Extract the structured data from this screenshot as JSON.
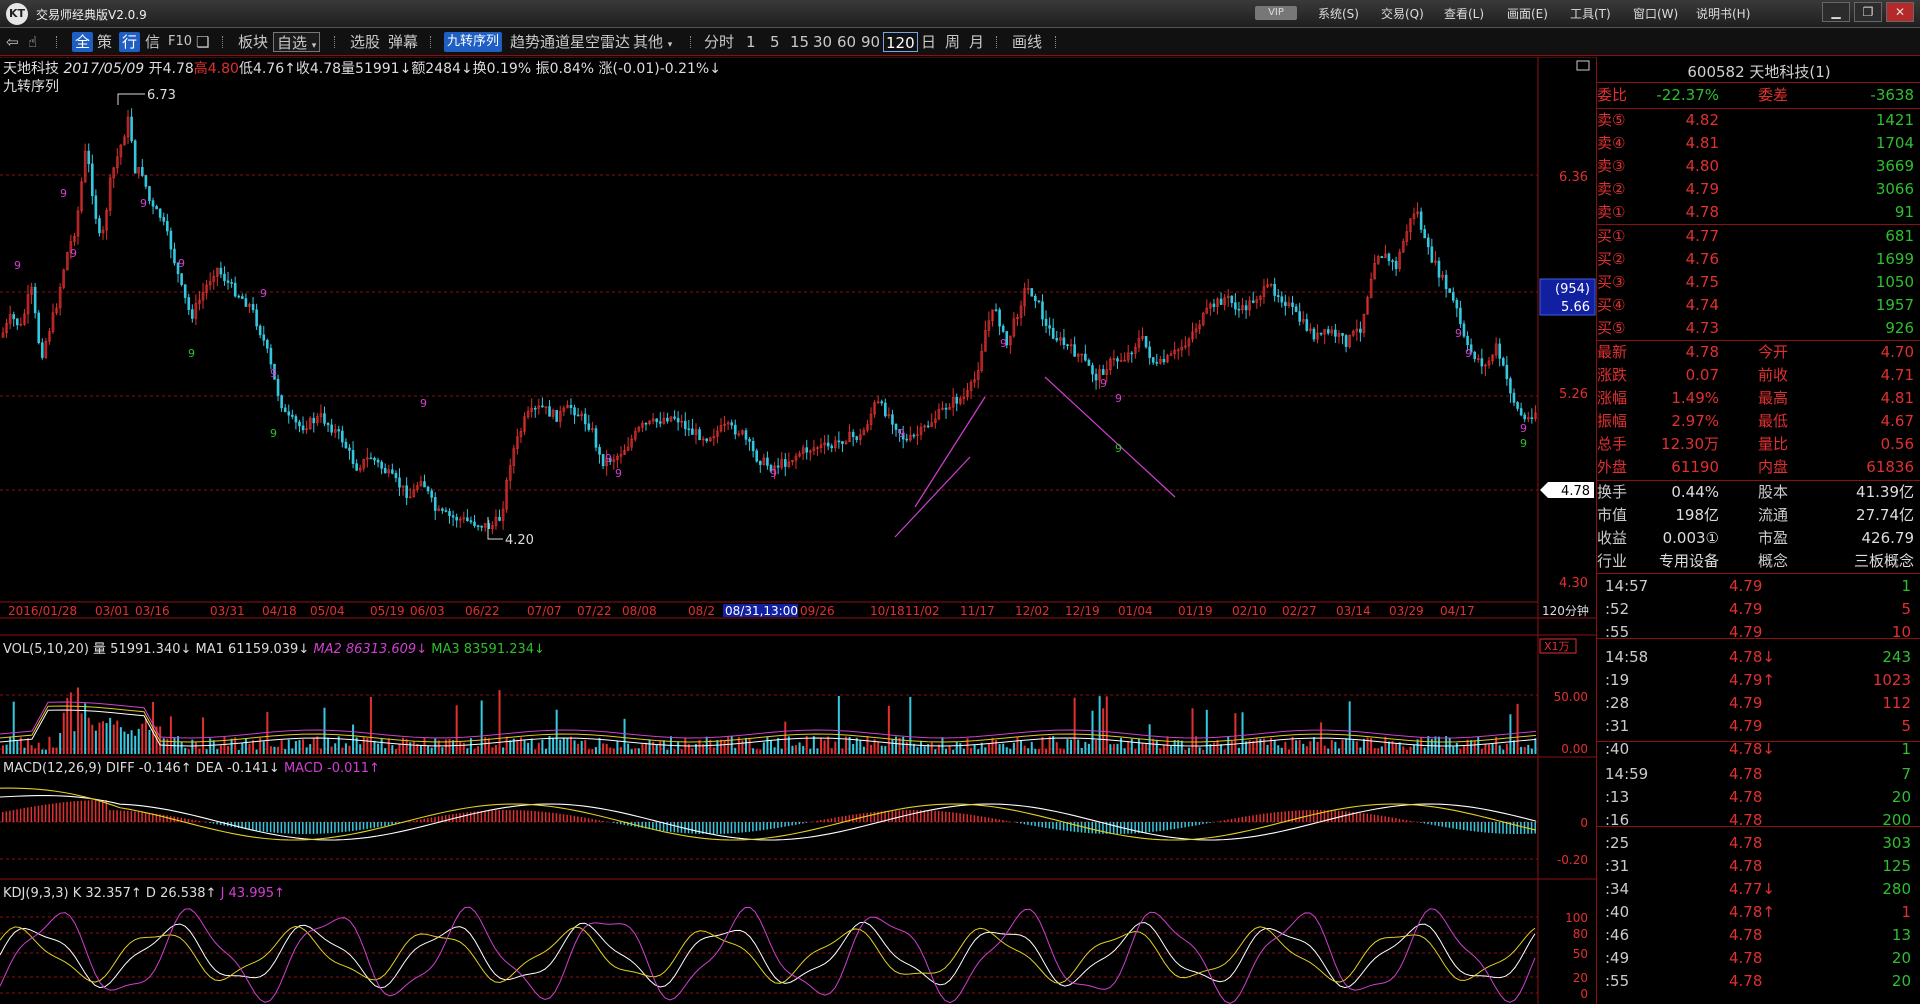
{
  "app": {
    "title": "交易师经典版V2.0.9",
    "logo_text": "KT",
    "vip": "VIP"
  },
  "menu": [
    "系统(S)",
    "交易(Q)",
    "查看(L)",
    "画面(E)",
    "工具(T)",
    "窗口(W)",
    "说明书(H)"
  ],
  "toolbar": {
    "quick": [
      "全",
      "策",
      "行",
      "信",
      "F10"
    ],
    "bankuai": "板块",
    "zixuan": "自选",
    "items": [
      "选股",
      "弹幕"
    ],
    "indicator_active": "九转序列",
    "items2": [
      "趋势通道",
      "星空雷达",
      "其他"
    ],
    "fenshi": "分时",
    "periods": [
      "1",
      "5",
      "15",
      "30",
      "60",
      "90",
      "120",
      "日",
      "周",
      "月"
    ],
    "period_active": "120",
    "huaxian": "画线"
  },
  "chart": {
    "header": {
      "name": "天地科技",
      "date": "2017/05/09",
      "open": "开4.78",
      "high": "高4.80",
      "low": "低4.76↑",
      "close": "收4.78",
      "volume": "量51991↓",
      "amount": "额2484↓",
      "turnover": "换0.19%",
      "amplitude": "振0.84%",
      "change": "涨(-0.01)-0.21%↓"
    },
    "indicator_name": "九转序列",
    "price_axis": [
      "6.36",
      "5.26",
      "4.30"
    ],
    "crosshair_label_top": "(954)",
    "crosshair_label_price": "5.66",
    "last_price_tag": "4.78",
    "high_annotation": "6.73",
    "low_annotation": "4.20",
    "period_label": "120分钟",
    "dates": [
      "2016/01/28",
      "03/01",
      "03/16",
      "03/31",
      "04/18",
      "05/04",
      "05/19",
      "06/03",
      "06/22",
      "07/07",
      "07/22",
      "08/08",
      "08/2",
      "08/31,13:00",
      "09/26",
      "10/18",
      "11/02",
      "11/17",
      "12/02",
      "12/19",
      "01/04",
      "01/19",
      "02/10",
      "02/27",
      "03/14",
      "03/29",
      "04/17"
    ],
    "vol": {
      "label": "VOL(5,10,20)",
      "vol": "量 51991.340↓",
      "ma1": "MA1 61159.039↓",
      "ma2": "MA2 86313.609↓",
      "ma3": "MA3 83591.234↓",
      "unit": "X1万",
      "axis": [
        "50.00",
        "0.00"
      ]
    },
    "macd": {
      "label": "MACD(12,26,9)",
      "diff": "DIFF -0.146↑",
      "dea": "DEA -0.141↓",
      "macd": "MACD -0.011↑",
      "axis": [
        "0",
        "-0.20"
      ]
    },
    "kdj": {
      "label": "KDJ(9,3,3)",
      "k": "K 32.357↑",
      "d": "D 26.538↑",
      "j": "J 43.995↑",
      "axis": [
        "100",
        "80",
        "50",
        "20",
        "0"
      ]
    },
    "colors": {
      "up": "#e03030",
      "down": "#35c8e0",
      "grid": "#8c1010",
      "ma1": "#ffffff",
      "ma2": "#e0d020",
      "ma3": "#d040d0"
    }
  },
  "quote": {
    "title": "600582 天地科技(1)",
    "weibi_label": "委比",
    "weibi": "-22.37%",
    "weicha_label": "委差",
    "weicha": "-3638",
    "asks": [
      {
        "label": "卖⑤",
        "price": "4.82",
        "vol": "1421"
      },
      {
        "label": "卖④",
        "price": "4.81",
        "vol": "1704"
      },
      {
        "label": "卖③",
        "price": "4.80",
        "vol": "3669"
      },
      {
        "label": "卖②",
        "price": "4.79",
        "vol": "3066"
      },
      {
        "label": "卖①",
        "price": "4.78",
        "vol": "91"
      }
    ],
    "bids": [
      {
        "label": "买①",
        "price": "4.77",
        "vol": "681"
      },
      {
        "label": "买②",
        "price": "4.76",
        "vol": "1699"
      },
      {
        "label": "买③",
        "price": "4.75",
        "vol": "1050"
      },
      {
        "label": "买④",
        "price": "4.74",
        "vol": "1957"
      },
      {
        "label": "买⑤",
        "price": "4.73",
        "vol": "926"
      }
    ],
    "stats1": [
      {
        "l": "最新",
        "v": "4.78",
        "l2": "今开",
        "v2": "4.70"
      },
      {
        "l": "涨跌",
        "v": "0.07",
        "l2": "前收",
        "v2": "4.71"
      },
      {
        "l": "涨幅",
        "v": "1.49%",
        "l2": "最高",
        "v2": "4.81"
      },
      {
        "l": "振幅",
        "v": "2.97%",
        "l2": "最低",
        "v2": "4.67"
      },
      {
        "l": "总手",
        "v": "12.30万",
        "l2": "量比",
        "v2": "0.56"
      },
      {
        "l": "外盘",
        "v": "61190",
        "l2": "内盘",
        "v2": "61836"
      }
    ],
    "stats2": [
      {
        "l": "换手",
        "v": "0.44%",
        "l2": "股本",
        "v2": "41.39亿"
      },
      {
        "l": "市值",
        "v": "198亿",
        "l2": "流通",
        "v2": "27.74亿"
      },
      {
        "l": "收益",
        "v": "0.003①",
        "l2": "市盈",
        "v2": "426.79"
      },
      {
        "l": "行业",
        "v": "专用设备",
        "l2": "概念",
        "v2": "三板概念"
      }
    ],
    "ticks": [
      {
        "t": "14:57",
        "p": "4.79",
        "v": "1",
        "c": "g"
      },
      {
        "t": ":52",
        "p": "4.79",
        "v": "5",
        "c": "r"
      },
      {
        "t": ":55",
        "p": "4.79",
        "v": "10",
        "c": "r"
      },
      {
        "t": "14:58",
        "p": "4.78↓",
        "v": "243",
        "c": "g"
      },
      {
        "t": ":19",
        "p": "4.79↑",
        "v": "1023",
        "c": "r"
      },
      {
        "t": ":28",
        "p": "4.79",
        "v": "112",
        "c": "r"
      },
      {
        "t": ":31",
        "p": "4.79",
        "v": "5",
        "c": "r"
      },
      {
        "t": ":40",
        "p": "4.78↓",
        "v": "1",
        "c": "g"
      },
      {
        "t": "14:59",
        "p": "4.78",
        "v": "7",
        "c": "g"
      },
      {
        "t": ":13",
        "p": "4.78",
        "v": "20",
        "c": "g"
      },
      {
        "t": ":16",
        "p": "4.78",
        "v": "200",
        "c": "g"
      },
      {
        "t": ":25",
        "p": "4.78",
        "v": "303",
        "c": "g"
      },
      {
        "t": ":31",
        "p": "4.78",
        "v": "125",
        "c": "g"
      },
      {
        "t": ":34",
        "p": "4.77↓",
        "v": "280",
        "c": "g"
      },
      {
        "t": ":40",
        "p": "4.78↑",
        "v": "1",
        "c": "r"
      },
      {
        "t": ":46",
        "p": "4.78",
        "v": "13",
        "c": "g"
      },
      {
        "t": ":49",
        "p": "4.78",
        "v": "20",
        "c": "g"
      },
      {
        "t": ":55",
        "p": "4.78",
        "v": "20",
        "c": "g"
      }
    ]
  }
}
